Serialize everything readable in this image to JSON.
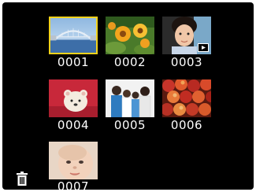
{
  "gallery": {
    "items": [
      {
        "number": "0001",
        "subject": "bridge",
        "selected": true
      },
      {
        "number": "0002",
        "subject": "flowers",
        "selected": false
      },
      {
        "number": "0003",
        "subject": "child",
        "selected": false,
        "badge": "video-play-icon"
      },
      {
        "number": "0004",
        "subject": "toy-bear",
        "selected": false
      },
      {
        "number": "0005",
        "subject": "family",
        "selected": false
      },
      {
        "number": "0006",
        "subject": "apples",
        "selected": false
      },
      {
        "number": "0007",
        "subject": "baby",
        "selected": false
      }
    ]
  },
  "controls": {
    "delete_icon": "trash-icon"
  },
  "colors": {
    "background": "#000000",
    "selection": "#f2d21c",
    "label": "#ffffff"
  }
}
